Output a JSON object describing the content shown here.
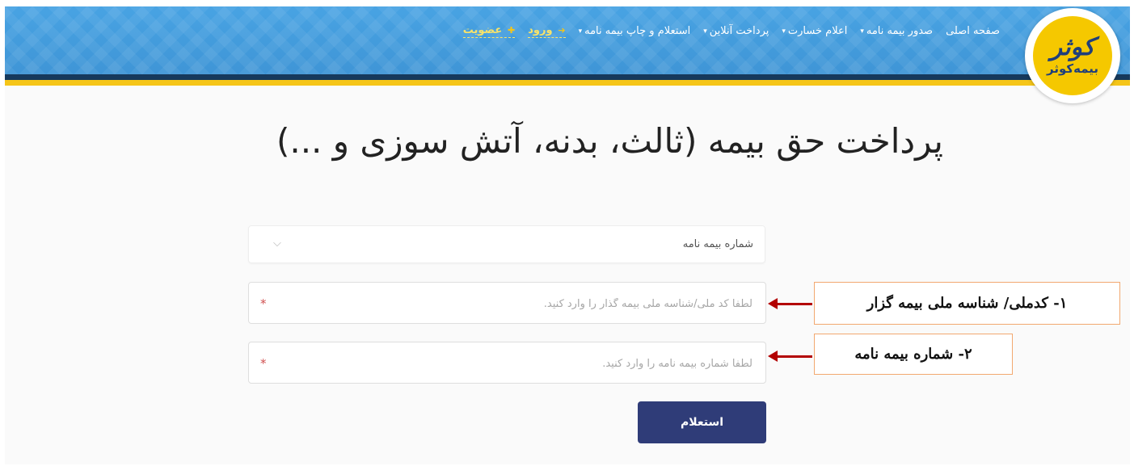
{
  "header": {
    "logo": {
      "glyph": "کوثر",
      "text": "بیمه‌کوثر"
    },
    "nav": [
      {
        "label": "صفحه اصلی",
        "has_dropdown": false
      },
      {
        "label": "صدور بیمه نامه",
        "has_dropdown": true
      },
      {
        "label": "اعلام خسارت",
        "has_dropdown": true
      },
      {
        "label": "پرداخت آنلاین",
        "has_dropdown": true
      },
      {
        "label": "استعلام و چاپ بیمه نامه",
        "has_dropdown": true
      }
    ],
    "login_label": "ورود",
    "register_label": "عضویت",
    "colors": {
      "bar": "#3f95d6",
      "stripe_dark": "#16395c",
      "stripe_yellow": "#f5c518"
    }
  },
  "main": {
    "title": "پرداخت حق بیمه (ثالث، بدنه، آتش سوزی و ...)",
    "select": {
      "value": "شماره بیمه نامه",
      "icon": "chevron-down-icon"
    },
    "national_id": {
      "placeholder": "لطفا کد ملی/شناسه ملی بیمه گذار را وارد کنید.",
      "value": "",
      "required_mark": "*"
    },
    "policy_number": {
      "placeholder": "لطفا شماره بیمه نامه را وارد کنید.",
      "value": "",
      "required_mark": "*"
    },
    "submit_label": "استعلام",
    "submit_color": "#2f3c78"
  },
  "annotations": {
    "note1": "۱- کدملی/ شناسه ملی بیمه گزار",
    "note2": "۲- شماره بیمه نامه",
    "arrow_color": "#b30000"
  }
}
